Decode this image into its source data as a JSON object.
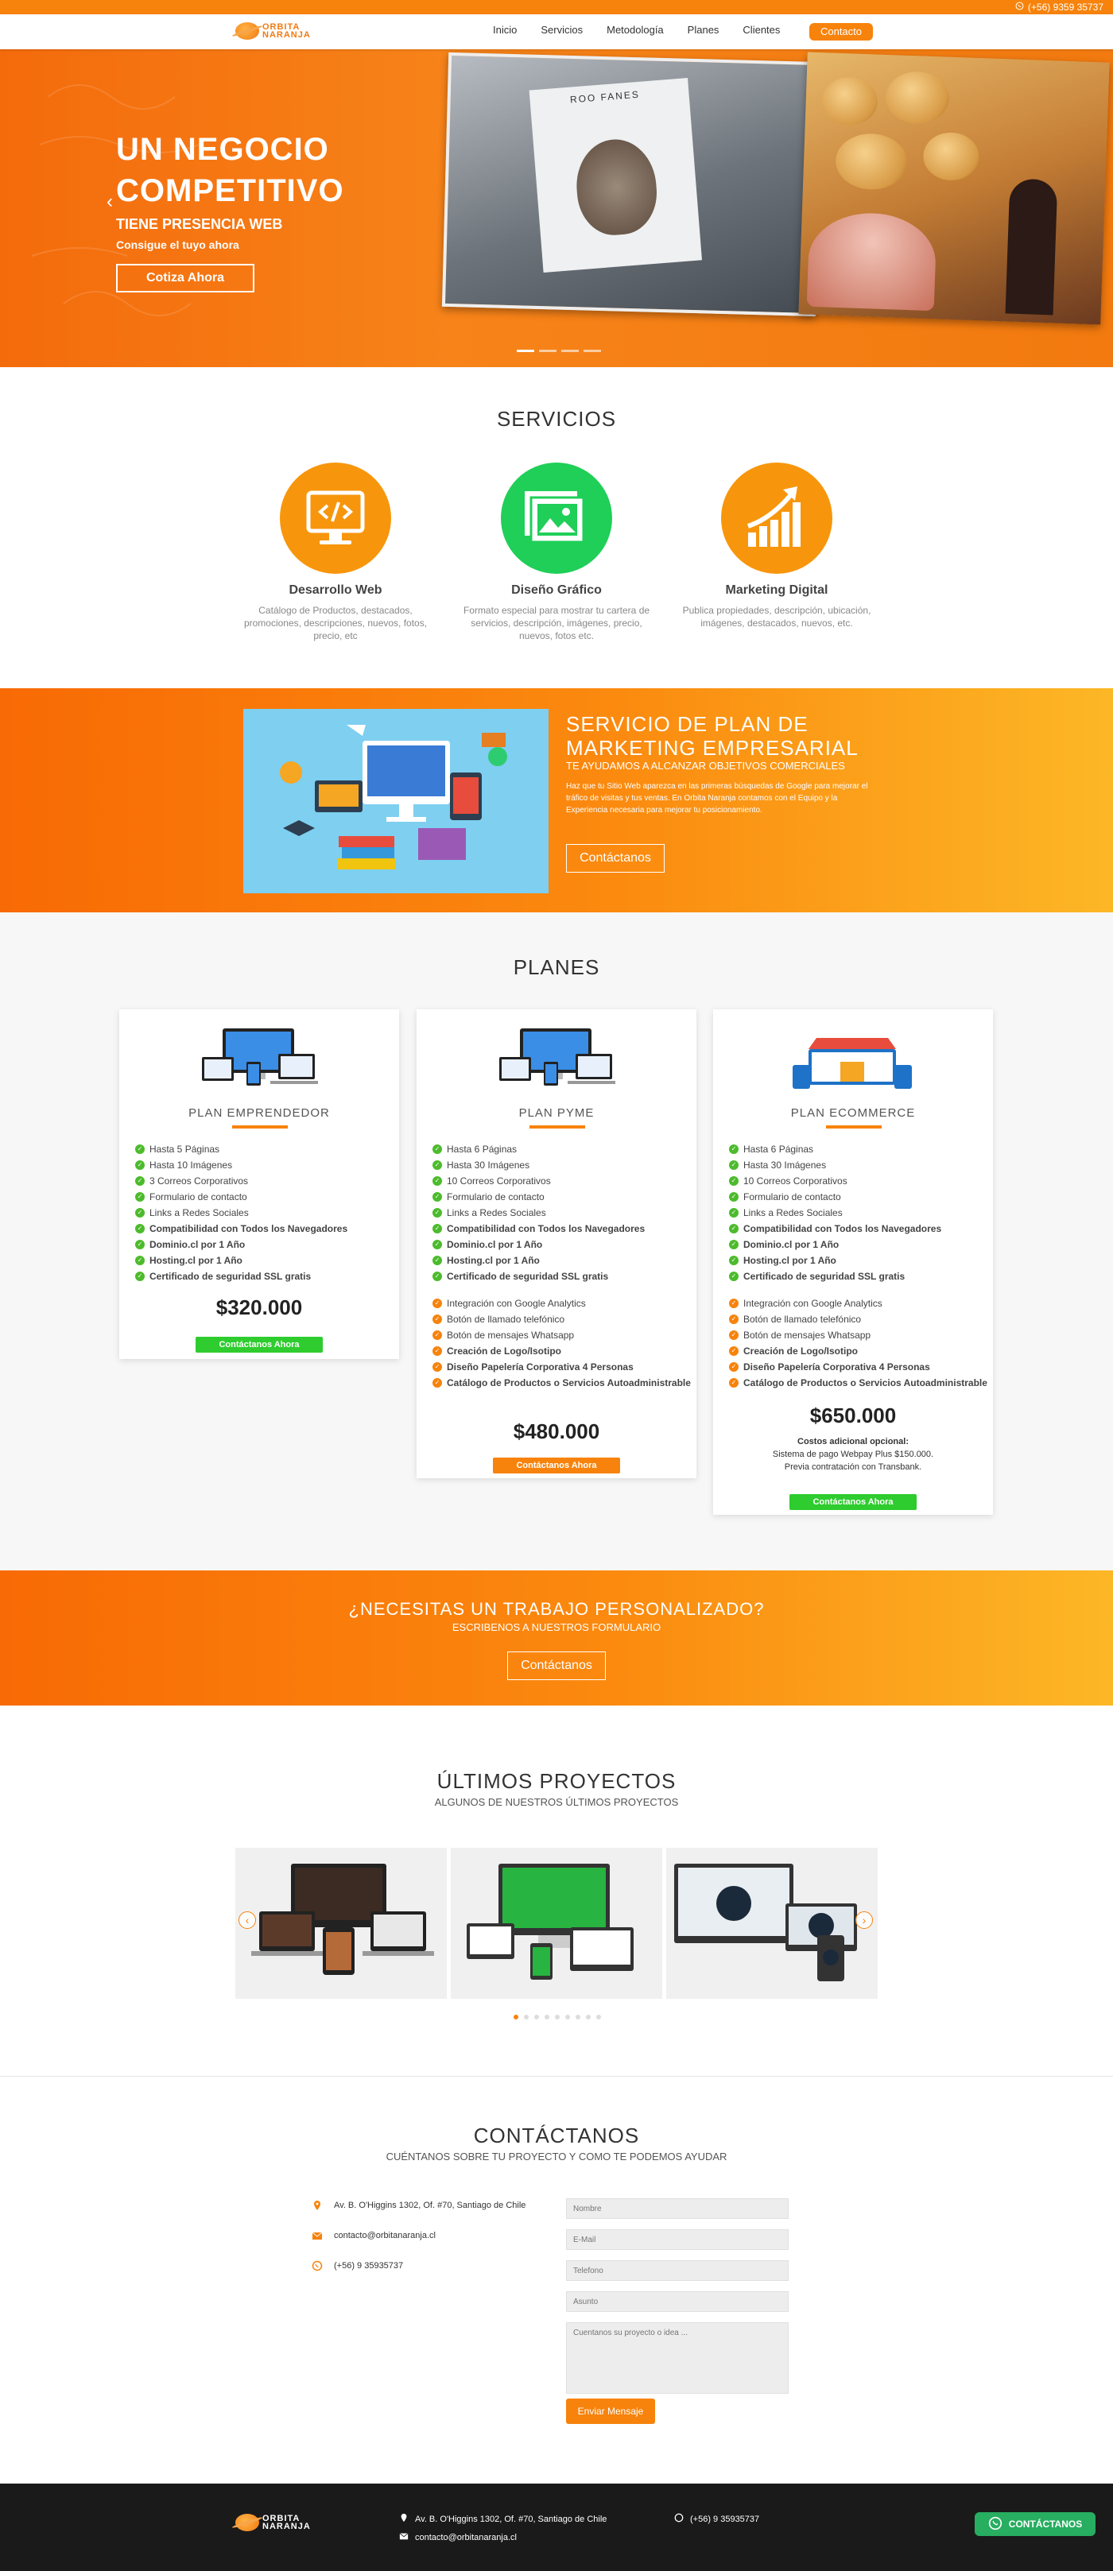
{
  "topbar": {
    "phone": "(+56) 9359 35737"
  },
  "brand": {
    "line1": "ORBITA",
    "line2": "NARANJA"
  },
  "nav": {
    "items": [
      "Inicio",
      "Servicios",
      "Metodología",
      "Planes",
      "Clientes"
    ],
    "cta": "Contacto"
  },
  "hero": {
    "title_line1": "UN NEGOCIO",
    "title_line2": "COMPETITIVO",
    "subtitle": "TIENE PRESENCIA WEB",
    "tagline": "Consigue el tuyo ahora",
    "button": "Cotiza Ahora",
    "record_label": "ROO FANES",
    "slides_total": 4,
    "slide_active": 1
  },
  "services": {
    "title": "SERVICIOS",
    "items": [
      {
        "name": "Desarrollo Web",
        "desc": "Catálogo de Productos, destacados, promociones, descripciones, nuevos, fotos, precio, etc",
        "icon": "code-monitor-icon",
        "color": "#f7960c"
      },
      {
        "name": "Diseño Gráfico",
        "desc": "Formato especial para mostrar tu cartera de servicios, descripción, imágenes, precio, nuevos, fotos etc.",
        "icon": "image-gallery-icon",
        "color": "#1fcf58"
      },
      {
        "name": "Marketing Digital",
        "desc": "Publica propiedades, descripción, ubicación, imágenes, destacados, nuevos, etc.",
        "icon": "growth-chart-icon",
        "color": "#f7960c"
      }
    ]
  },
  "marketing": {
    "title_line1": "SERVICIO DE PLAN DE",
    "title_line2": "MARKETING EMPRESARIAL",
    "tagline": "TE AYUDAMOS A ALCANZAR OBJETIVOS COMERCIALES",
    "description": "Haz que tu Sitio Web aparezca en las primeras búsquedas de Google para mejorar el tráfico de visitas y tus ventas. En Orbita Naranja contamos con el Equipo y la Experiencia necesaria para mejorar tu posicionamiento.",
    "button": "Contáctanos"
  },
  "plans": {
    "title": "PLANES",
    "items": [
      {
        "name": "PLAN EMPRENDEDOR",
        "features": [
          {
            "t": "Hasta 5 Páginas",
            "b": false
          },
          {
            "t": "Hasta 10 Imágenes",
            "b": false
          },
          {
            "t": "3 Correos Corporativos",
            "b": false
          },
          {
            "t": "Formulario de contacto",
            "b": false
          },
          {
            "t": "Links a Redes Sociales",
            "b": false
          },
          {
            "t": "Compatibilidad con Todos los Navegadores",
            "b": true
          },
          {
            "t": "Dominio.cl por 1 Año",
            "b": true
          },
          {
            "t": "Hosting.cl por 1 Año",
            "b": true
          },
          {
            "t": "Certificado de seguridad SSL gratis",
            "b": true
          }
        ],
        "extras": [],
        "price": "$320.000",
        "note_title": "",
        "note": [],
        "button": "Contáctanos Ahora",
        "button_color": "#2ecc2e"
      },
      {
        "name": "PLAN PYME",
        "features": [
          {
            "t": "Hasta 6 Páginas",
            "b": false
          },
          {
            "t": "Hasta 30 Imágenes",
            "b": false
          },
          {
            "t": "10 Correos Corporativos",
            "b": false
          },
          {
            "t": "Formulario de contacto",
            "b": false
          },
          {
            "t": "Links a Redes Sociales",
            "b": false
          },
          {
            "t": "Compatibilidad con Todos los Navegadores",
            "b": true
          },
          {
            "t": "Dominio.cl por 1 Año",
            "b": true
          },
          {
            "t": "Hosting.cl por 1 Año",
            "b": true
          },
          {
            "t": "Certificado de seguridad SSL gratis",
            "b": true
          }
        ],
        "extras": [
          {
            "t": "Integración con Google Analytics",
            "b": false
          },
          {
            "t": "Botón de llamado telefónico",
            "b": false
          },
          {
            "t": "Botón de mensajes Whatsapp",
            "b": false
          },
          {
            "t": "Creación de Logo/Isotipo",
            "b": true
          },
          {
            "t": "Diseño Papelería Corporativa 4 Personas",
            "b": true
          },
          {
            "t": "Catálogo de Productos o Servicios Autoadministrable",
            "b": true
          }
        ],
        "price": "$480.000",
        "note_title": "",
        "note": [],
        "button": "Contáctanos Ahora",
        "button_color": "#f7830c"
      },
      {
        "name": "PLAN ECOMMERCE",
        "features": [
          {
            "t": "Hasta 6 Páginas",
            "b": false
          },
          {
            "t": "Hasta 30 Imágenes",
            "b": false
          },
          {
            "t": "10 Correos Corporativos",
            "b": false
          },
          {
            "t": "Formulario de contacto",
            "b": false
          },
          {
            "t": "Links a Redes Sociales",
            "b": false
          },
          {
            "t": "Compatibilidad con Todos los Navegadores",
            "b": true
          },
          {
            "t": "Dominio.cl por 1 Año",
            "b": true
          },
          {
            "t": "Hosting.cl por 1 Año",
            "b": true
          },
          {
            "t": "Certificado de seguridad SSL gratis",
            "b": true
          }
        ],
        "extras": [
          {
            "t": "Integración con Google Analytics",
            "b": false
          },
          {
            "t": "Botón de llamado telefónico",
            "b": false
          },
          {
            "t": "Botón de mensajes Whatsapp",
            "b": false
          },
          {
            "t": "Creación de Logo/Isotipo",
            "b": true
          },
          {
            "t": "Diseño Papelería Corporativa 4 Personas",
            "b": true
          },
          {
            "t": "Catálogo de Productos o Servicios Autoadministrable",
            "b": true
          }
        ],
        "price": "$650.000",
        "note_title": "Costos adicional opcional:",
        "note": [
          "Sistema de pago Webpay Plus $150.000.",
          "Previa contratación con Transbank."
        ],
        "button": "Contáctanos Ahora",
        "button_color": "#2ecc2e"
      }
    ]
  },
  "custom": {
    "title": "¿NECESITAS UN TRABAJO PERSONALIZADO?",
    "tagline": "ESCRIBENOS A NUESTROS FORMULARIO",
    "button": "Contáctanos"
  },
  "projects": {
    "title": "ÚLTIMOS PROYECTOS",
    "subtitle": "ALGUNOS DE NUESTROS ÚLTIMOS PROYECTOS",
    "pages_total": 9,
    "page_active": 1,
    "items": [
      {
        "screen_color": "#2a2a2a"
      },
      {
        "screen_color": "#27b440"
      },
      {
        "screen_color": "#e9eef2"
      }
    ]
  },
  "contact": {
    "title": "CONTÁCTANOS",
    "subtitle": "CUÉNTANOS SOBRE TU PROYECTO Y COMO TE PODEMOS AYUDAR",
    "address": "Av. B. O'Higgins 1302, Of. #70, Santiago de Chile",
    "email": "contacto@orbitanaranja.cl",
    "phone": "(+56) 9 35935737",
    "form": {
      "name_placeholder": "Nombre",
      "email_placeholder": "E-Mail",
      "phone_placeholder": "Telefono",
      "subject_placeholder": "Asunto",
      "message_placeholder": "Cuentanos su proyecto o idea ...",
      "submit": "Enviar Mensaje"
    }
  },
  "footer": {
    "address": "Av. B. O'Higgins 1302, Of. #70, Santiago de Chile",
    "email": "contacto@orbitanaranja.cl",
    "phone": "(+56) 9 35935737",
    "whatsapp_button": "CONTÁCTANOS"
  },
  "colors": {
    "brand_orange": "#f7830c",
    "green": "#2ecc2e",
    "dark": "#1a1a1a"
  }
}
